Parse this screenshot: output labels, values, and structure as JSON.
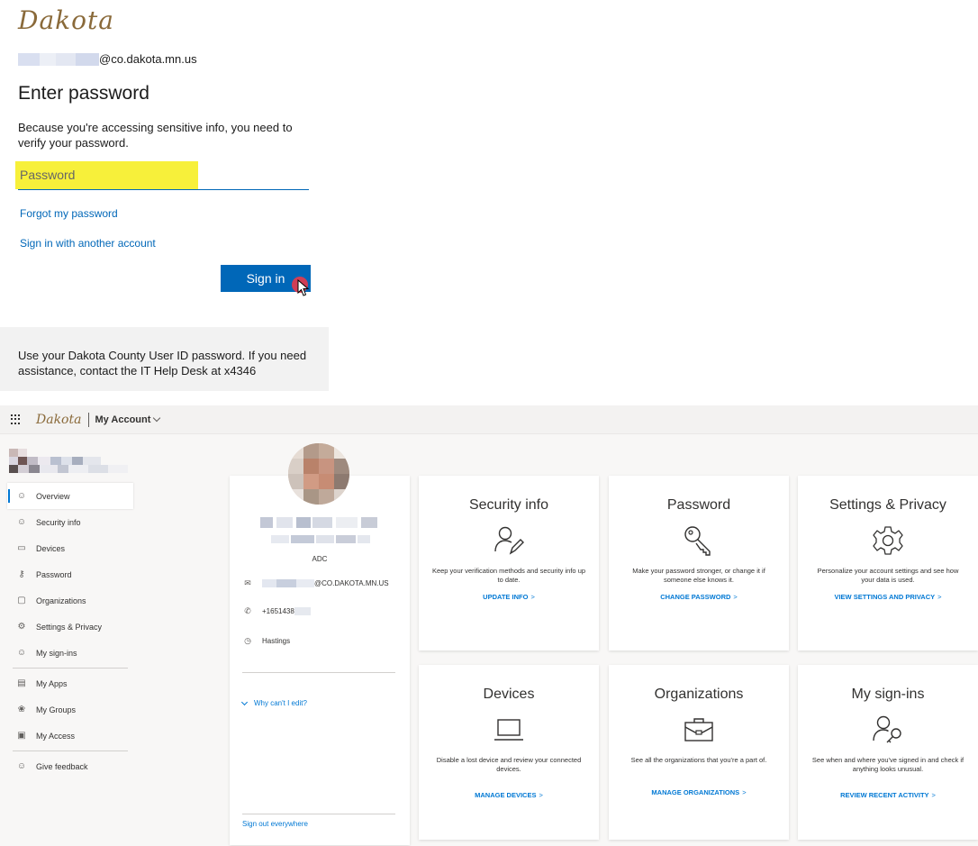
{
  "signin": {
    "logo_text": "Dakota",
    "email_domain": "@co.dakota.mn.us",
    "heading": "Enter password",
    "description": "Because you're accessing sensitive info, you need to verify your password.",
    "password_placeholder": "Password",
    "forgot_link": "Forgot my password",
    "another_account_link": "Sign in with another account",
    "signin_button": "Sign in",
    "notice": "Use your Dakota County User ID password. If you need assistance, contact the IT Help Desk at x4346"
  },
  "account": {
    "topbar": {
      "logo_text": "Dakota",
      "title": "My Account"
    },
    "nav": [
      {
        "label": "Overview",
        "icon": "person-icon",
        "glyph": "☺"
      },
      {
        "label": "Security info",
        "icon": "security-info-icon",
        "glyph": "☺"
      },
      {
        "label": "Devices",
        "icon": "laptop-icon",
        "glyph": "▭"
      },
      {
        "label": "Password",
        "icon": "key-icon",
        "glyph": "⚷"
      },
      {
        "label": "Organizations",
        "icon": "briefcase-icon",
        "glyph": "▢"
      },
      {
        "label": "Settings & Privacy",
        "icon": "gear-icon",
        "glyph": "⚙"
      },
      {
        "label": "My sign-ins",
        "icon": "sign-ins-icon",
        "glyph": "☺"
      },
      {
        "label": "My Apps",
        "icon": "apps-icon",
        "glyph": "▤"
      },
      {
        "label": "My Groups",
        "icon": "groups-icon",
        "glyph": "❀"
      },
      {
        "label": "My Access",
        "icon": "access-icon",
        "glyph": "▣"
      },
      {
        "label": "Give feedback",
        "icon": "feedback-icon",
        "glyph": "☺"
      }
    ],
    "profile": {
      "org": "ADC",
      "email": "@CO.DAKOTA.MN.US",
      "phone": "+1651438",
      "location": "Hastings",
      "why_cant_edit": "Why can't I edit?",
      "sign_out_everywhere": "Sign out everywhere"
    },
    "tiles": [
      {
        "title": "Security info",
        "icon": "security-info-icon",
        "desc": "Keep your verification methods and security info up to date.",
        "link": "UPDATE INFO"
      },
      {
        "title": "Password",
        "icon": "key-icon",
        "desc": "Make your password stronger, or change it if someone else knows it.",
        "link": "CHANGE PASSWORD"
      },
      {
        "title": "Settings & Privacy",
        "icon": "gear-icon",
        "desc": "Personalize your account settings and see how your data is used.",
        "link": "VIEW SETTINGS AND PRIVACY"
      },
      {
        "title": "Devices",
        "icon": "laptop-icon",
        "desc": "Disable a lost device and review your connected devices.",
        "link": "MANAGE DEVICES"
      },
      {
        "title": "Organizations",
        "icon": "briefcase-icon",
        "desc": "See all the organizations that you're a part of.",
        "link": "MANAGE ORGANIZATIONS"
      },
      {
        "title": "My sign-ins",
        "icon": "sign-ins-icon",
        "desc": "See when and where you've signed in and check if anything looks unusual.",
        "link": "REVIEW RECENT ACTIVITY"
      }
    ],
    "link_arrow": ">"
  },
  "colors": {
    "accent": "#0067b8",
    "highlight": "#f7f03a",
    "cursor_dot": "#e53a4b",
    "notice_bg": "#f2f2f2"
  }
}
